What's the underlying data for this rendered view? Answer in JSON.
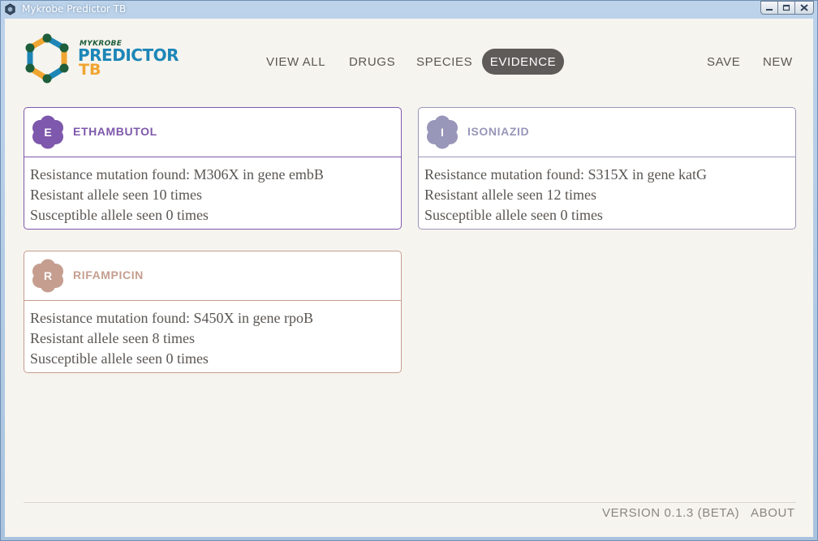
{
  "window": {
    "title": "Mykrobe Predictor TB"
  },
  "brand": {
    "small": "MYKROBE",
    "main": "PREDICTOR",
    "tb": "TB"
  },
  "nav": {
    "view_all": "VIEW ALL",
    "drugs": "DRUGS",
    "species": "SPECIES",
    "evidence": "EVIDENCE",
    "save": "SAVE",
    "new": "NEW"
  },
  "cards": [
    {
      "letter": "E",
      "name": "ETHAMBUTOL",
      "color": "#7e58ac",
      "lines": [
        "Resistance mutation found: M306X in gene embB",
        "Resistant allele seen 10 times",
        "Susceptible allele seen 0 times"
      ]
    },
    {
      "letter": "I",
      "name": "ISONIAZID",
      "color": "#9896b9",
      "lines": [
        "Resistance mutation found: S315X in gene katG",
        "Resistant allele seen 12 times",
        "Susceptible allele seen 0 times"
      ]
    },
    {
      "letter": "R",
      "name": "RIFAMPICIN",
      "color": "#c59e8f",
      "lines": [
        "Resistance mutation found: S450X in gene rpoB",
        "Resistant allele seen 8 times",
        "Susceptible allele seen 0 times"
      ]
    }
  ],
  "footer": {
    "version": "VERSION 0.1.3 (BETA)",
    "about": "ABOUT"
  },
  "colors": {
    "active_tab": "#5e5b58",
    "background": "#f6f4ef",
    "logo_green": "#1e5e3a",
    "logo_blue": "#1d86b7",
    "logo_orange": "#f0a531"
  },
  "icons": {
    "app": "mykrobe-app-icon",
    "minimize": "minimize-icon",
    "maximize": "maximize-icon",
    "close": "close-icon"
  }
}
